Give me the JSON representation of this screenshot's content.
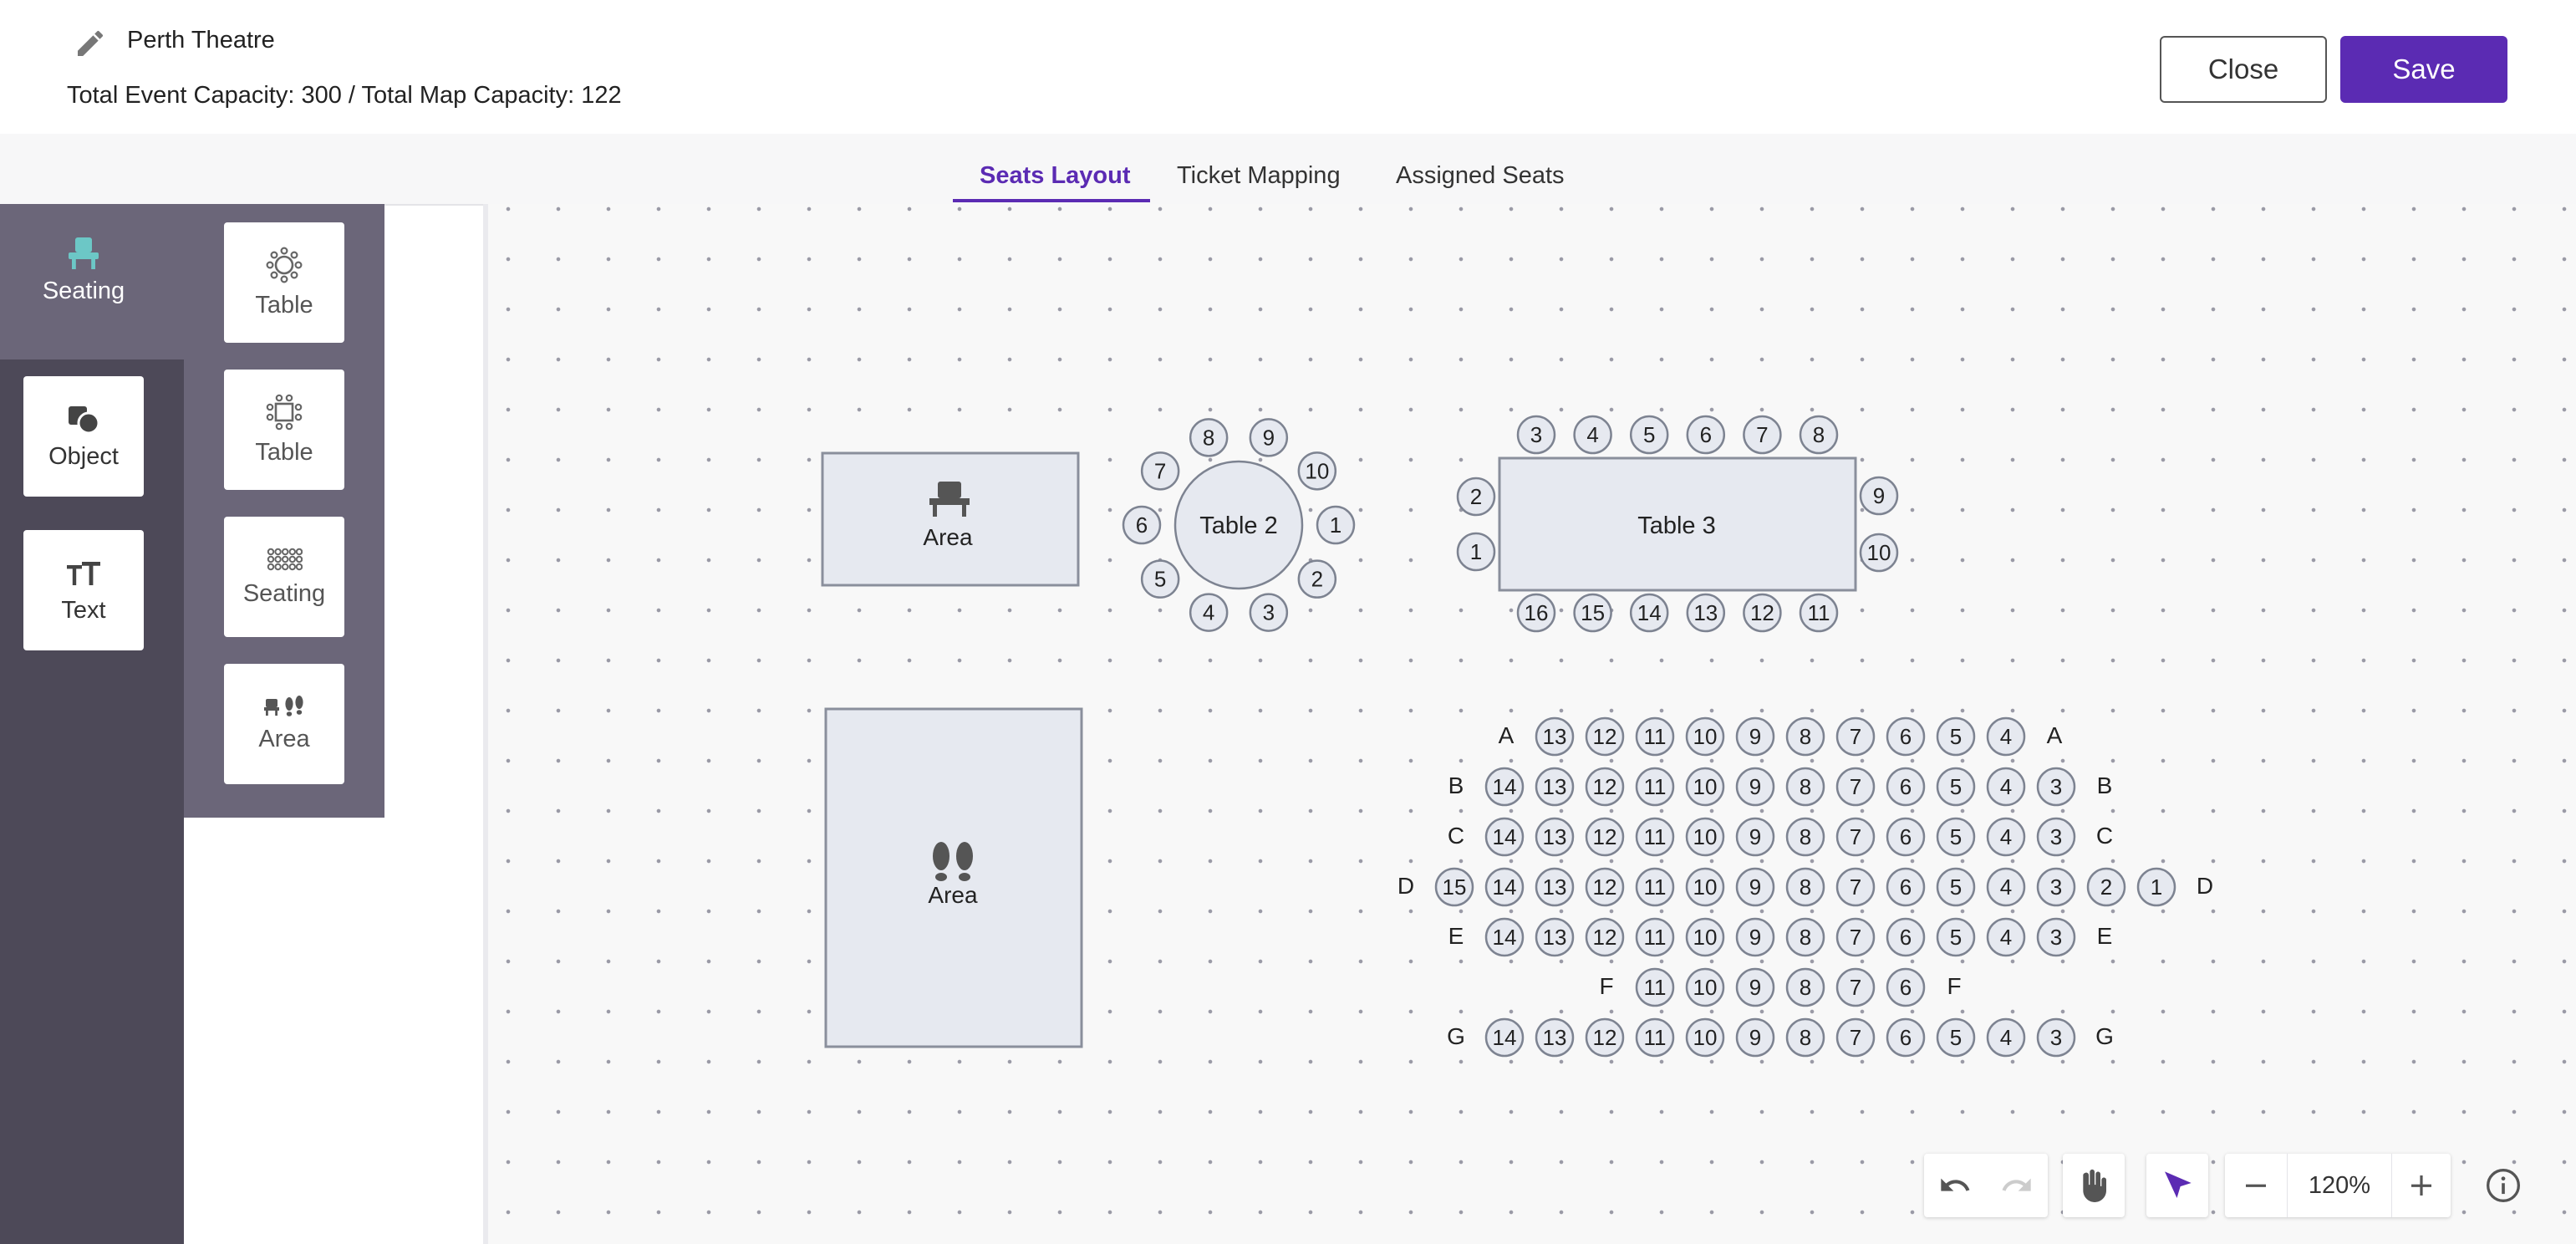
{
  "header": {
    "event_name": "Perth Theatre",
    "capacity_text": "Total Event Capacity: 300 / Total Map Capacity: 122",
    "close_label": "Close",
    "save_label": "Save"
  },
  "tabs": [
    {
      "label": "Seats Layout",
      "active": true
    },
    {
      "label": "Ticket Mapping",
      "active": false
    },
    {
      "label": "Assigned Seats",
      "active": false
    }
  ],
  "categories": [
    {
      "label": "Seating",
      "icon": "chair-icon",
      "active": true
    },
    {
      "label": "Object",
      "icon": "shapes-icon",
      "active": false
    },
    {
      "label": "Text",
      "icon": "text-size-icon",
      "active": false
    }
  ],
  "palette": [
    {
      "label": "Table",
      "icon": "round-table-icon"
    },
    {
      "label": "Table",
      "icon": "square-table-icon"
    },
    {
      "label": "Seating",
      "icon": "seat-grid-icon"
    },
    {
      "label": "Area",
      "icon": "area-icon"
    }
  ],
  "map": {
    "area1_label": "Area",
    "area2_label": "Area",
    "table2": {
      "label": "Table 2",
      "seats": [
        "1",
        "2",
        "3",
        "4",
        "5",
        "6",
        "7",
        "8",
        "9",
        "10"
      ]
    },
    "table3": {
      "label": "Table 3",
      "top_seats": [
        "3",
        "4",
        "5",
        "6",
        "7",
        "8"
      ],
      "bottom_seats": [
        "16",
        "15",
        "14",
        "13",
        "12",
        "11"
      ],
      "left_seats": [
        "2",
        "1"
      ],
      "right_seats": [
        "9",
        "10"
      ]
    },
    "rows": [
      {
        "label": "A",
        "seats": [
          "13",
          "12",
          "11",
          "10",
          "9",
          "8",
          "7",
          "6",
          "5",
          "4"
        ]
      },
      {
        "label": "B",
        "seats": [
          "14",
          "13",
          "12",
          "11",
          "10",
          "9",
          "8",
          "7",
          "6",
          "5",
          "4",
          "3"
        ]
      },
      {
        "label": "C",
        "seats": [
          "14",
          "13",
          "12",
          "11",
          "10",
          "9",
          "8",
          "7",
          "6",
          "5",
          "4",
          "3"
        ]
      },
      {
        "label": "D",
        "seats": [
          "15",
          "14",
          "13",
          "12",
          "11",
          "10",
          "9",
          "8",
          "7",
          "6",
          "5",
          "4",
          "3",
          "2",
          "1"
        ]
      },
      {
        "label": "E",
        "seats": [
          "14",
          "13",
          "12",
          "11",
          "10",
          "9",
          "8",
          "7",
          "6",
          "5",
          "4",
          "3"
        ]
      },
      {
        "label": "F",
        "seats": [
          "11",
          "10",
          "9",
          "8",
          "7",
          "6"
        ]
      },
      {
        "label": "G",
        "seats": [
          "14",
          "13",
          "12",
          "11",
          "10",
          "9",
          "8",
          "7",
          "6",
          "5",
          "4",
          "3"
        ]
      }
    ]
  },
  "toolbar": {
    "zoom": "120%",
    "tools": [
      "undo-icon",
      "redo-icon",
      "hand-icon",
      "pointer-icon",
      "minus-icon",
      "plus-icon",
      "info-icon"
    ]
  },
  "colors": {
    "accent": "#5b2bb3",
    "rail": "#4d4958",
    "rail_light": "#6b6679",
    "seat_fill": "#e6e9f0",
    "seat_stroke": "#7d8391",
    "chair_active": "#6cc7c6"
  }
}
